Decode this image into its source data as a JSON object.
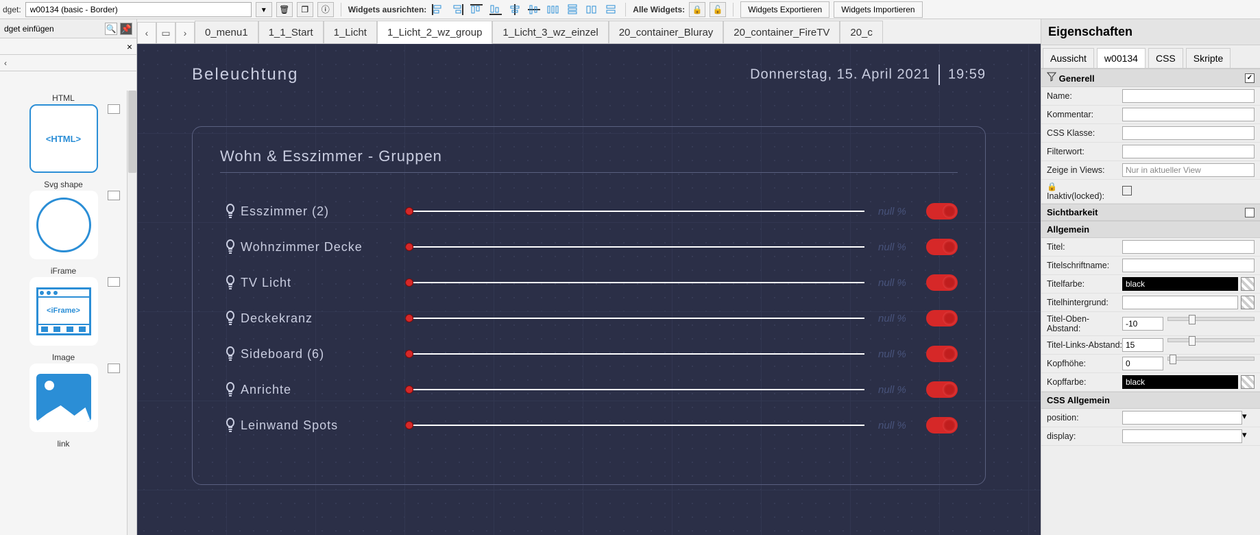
{
  "toolbar": {
    "widget_label": "dget:",
    "widget_value": "w00134 (basic - Border)",
    "align_label": "Widgets ausrichten:",
    "all_label": "Alle Widgets:",
    "export_btn": "Widgets Exportieren",
    "import_btn": "Widgets Importieren"
  },
  "left": {
    "insert_label": "dget einfügen",
    "items": [
      {
        "label": "HTML",
        "inner": "<HTML>",
        "kind": "html"
      },
      {
        "label": "Svg shape",
        "inner": "",
        "kind": "circle"
      },
      {
        "label": "iFrame",
        "inner": "<iFrame>",
        "kind": "iframe"
      },
      {
        "label": "Image",
        "inner": "",
        "kind": "image"
      },
      {
        "label": "link",
        "inner": "",
        "kind": "link"
      }
    ]
  },
  "tabs": {
    "items": [
      "0_menu1",
      "1_1_Start",
      "1_Licht",
      "1_Licht_2_wz_group",
      "1_Licht_3_wz_einzel",
      "20_container_Bluray",
      "20_container_FireTV",
      "20_c"
    ],
    "active": 3
  },
  "canvas": {
    "title": "Beleuchtung",
    "date": "Donnerstag, 15. April 2021",
    "time": "19:59",
    "group_title": "Wohn & Esszimmer - Gruppen",
    "rows": [
      {
        "name": "Esszimmer (2)",
        "val": "null %"
      },
      {
        "name": "Wohnzimmer Decke",
        "val": "null %"
      },
      {
        "name": "TV Licht",
        "val": "null %"
      },
      {
        "name": "Deckekranz",
        "val": "null %"
      },
      {
        "name": "Sideboard (6)",
        "val": "null %"
      },
      {
        "name": "Anrichte",
        "val": "null %"
      },
      {
        "name": "Leinwand Spots",
        "val": "null %"
      }
    ]
  },
  "props": {
    "title": "Eigenschaften",
    "tabs": [
      "Aussicht",
      "w00134",
      "CSS",
      "Skripte"
    ],
    "active_tab": 1,
    "sec_generell": "Generell",
    "name_lbl": "Name:",
    "kommentar_lbl": "Kommentar:",
    "css_klasse_lbl": "CSS Klasse:",
    "filterwort_lbl": "Filterwort:",
    "zeige_lbl": "Zeige in Views:",
    "zeige_val": "Nur in aktueller View",
    "inaktiv_lbl": "Inaktiv(locked):",
    "sec_sicht": "Sichtbarkeit",
    "sec_allgemein": "Allgemein",
    "titel_lbl": "Titel:",
    "titelschrift_lbl": "Titelschriftname:",
    "titelfarbe_lbl": "Titelfarbe:",
    "titelfarbe_val": "black",
    "titelhg_lbl": "Titelhintergrund:",
    "titel_oben_lbl": "Titel-Oben-Abstand:",
    "titel_oben_val": "-10",
    "titel_links_lbl": "Titel-Links-Abstand:",
    "titel_links_val": "15",
    "kopfhoehe_lbl": "Kopfhöhe:",
    "kopfhoehe_val": "0",
    "kopffarbe_lbl": "Kopffarbe:",
    "kopffarbe_val": "black",
    "sec_css": "CSS Allgemein",
    "position_lbl": "position:",
    "display_lbl": "display:"
  }
}
